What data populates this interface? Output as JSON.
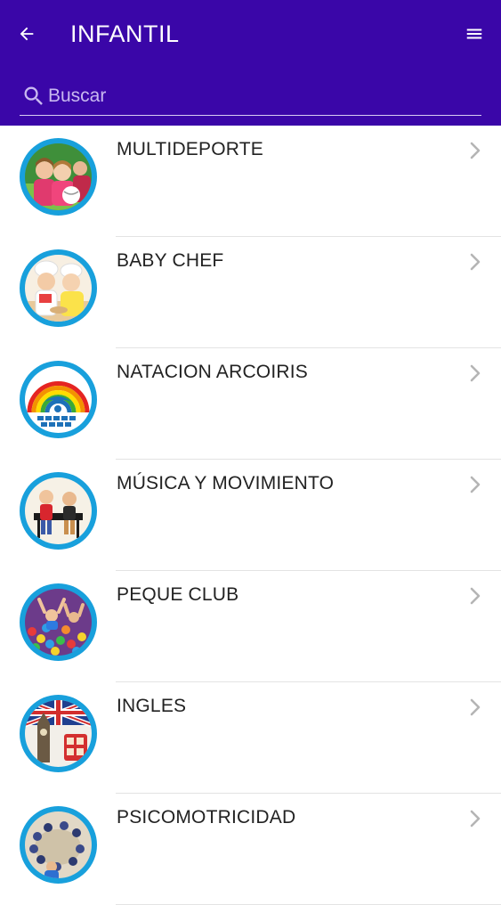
{
  "header": {
    "title": "INFANTIL",
    "back_icon": "arrow-left-icon",
    "menu_icon": "hamburger-menu-icon",
    "background_color": "#3a06a8"
  },
  "search": {
    "placeholder": "Buscar",
    "value": "",
    "icon": "search-icon"
  },
  "activities": [
    {
      "id": "multideporte",
      "label": "MULTIDEPORTE"
    },
    {
      "id": "baby-chef",
      "label": "BABY CHEF"
    },
    {
      "id": "natacion-arcoiris",
      "label": "NATACION ARCOIRIS"
    },
    {
      "id": "musica-y-movimiento",
      "label": "MÚSICA Y MOVIMIENTO"
    },
    {
      "id": "peque-club",
      "label": "PEQUE CLUB"
    },
    {
      "id": "ingles",
      "label": "INGLES"
    },
    {
      "id": "psicomotricidad",
      "label": "PSICOMOTRICIDAD"
    }
  ],
  "colors": {
    "accent": "#3a06a8",
    "avatar_ring": "#18a0dc",
    "chevron": "#b5b5b5"
  }
}
